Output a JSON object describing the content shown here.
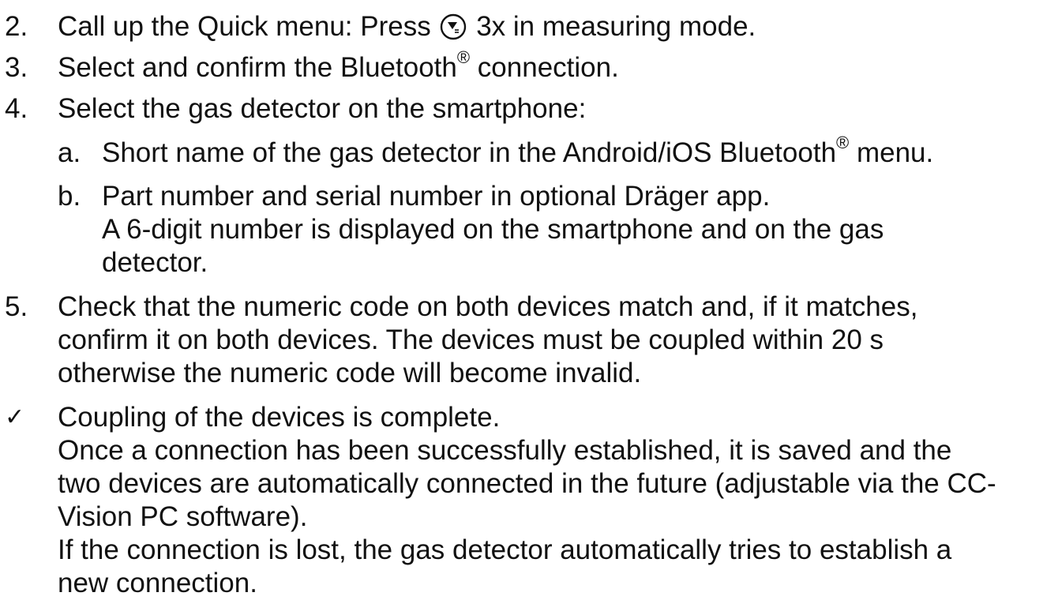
{
  "steps": [
    {
      "num": "2.",
      "pre": "Call up the Quick menu: Press",
      "post": "3x in measuring mode.",
      "icon": "down-menu-button-icon"
    },
    {
      "num": "3.",
      "pre": "Select and confirm the Bluetooth",
      "sup": "®",
      "post": " connection."
    },
    {
      "num": "4.",
      "text": "Select the gas detector on the smartphone:"
    }
  ],
  "substeps": [
    {
      "label": "a.",
      "pre": "Short name of the gas detector in the Android/iOS Bluetooth",
      "sup": "®",
      "post": " menu."
    },
    {
      "label": "b.",
      "lines": [
        "Part number and serial number in optional Dräger app.",
        "A 6-digit number is displayed on the smartphone and on the gas",
        "detector."
      ]
    }
  ],
  "step5": {
    "num": "5.",
    "lines": [
      "Check that the numeric code on both devices match and, if it matches,",
      "confirm it on both devices. The devices must be coupled within 20 s",
      "otherwise the numeric code will become invalid."
    ]
  },
  "result": {
    "symbol": "✓",
    "lines": [
      "Coupling of the devices is complete.",
      "Once a connection has been successfully established, it is saved and the",
      "two devices are automatically connected in the future (adjustable via the CC-",
      "Vision PC software).",
      "If the connection is lost, the gas detector automatically tries to establish a",
      "new connection."
    ]
  }
}
